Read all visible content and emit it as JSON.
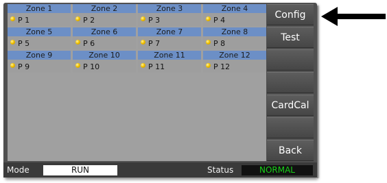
{
  "zones": [
    {
      "name": "Zone 1",
      "p": "P 1"
    },
    {
      "name": "Zone 2",
      "p": "P 2"
    },
    {
      "name": "Zone 3",
      "p": "P 3"
    },
    {
      "name": "Zone 4",
      "p": "P 4"
    },
    {
      "name": "Zone 5",
      "p": "P 5"
    },
    {
      "name": "Zone 6",
      "p": "P 6"
    },
    {
      "name": "Zone 7",
      "p": "P 7"
    },
    {
      "name": "Zone 8",
      "p": "P 8"
    },
    {
      "name": "Zone 9",
      "p": "P 9"
    },
    {
      "name": "Zone 10",
      "p": "P 10"
    },
    {
      "name": "Zone 11",
      "p": "P 11"
    },
    {
      "name": "Zone 12",
      "p": "P 12"
    }
  ],
  "side_buttons": {
    "config": "Config",
    "test": "Test",
    "blank1": "",
    "blank2": "",
    "cardcal": "CardCal",
    "blank3": "",
    "back": "Back"
  },
  "status_bar": {
    "mode_label": "Mode",
    "mode_value": "RUN",
    "status_label": "Status",
    "status_value": "NORMAL"
  },
  "colors": {
    "zone_header": "#6c8fc6",
    "indicator": "#f2c200",
    "status_ok": "#18d018"
  },
  "icons": {
    "indicator": "status-indicator-icon",
    "pointer": "arrow-pointer-icon"
  }
}
